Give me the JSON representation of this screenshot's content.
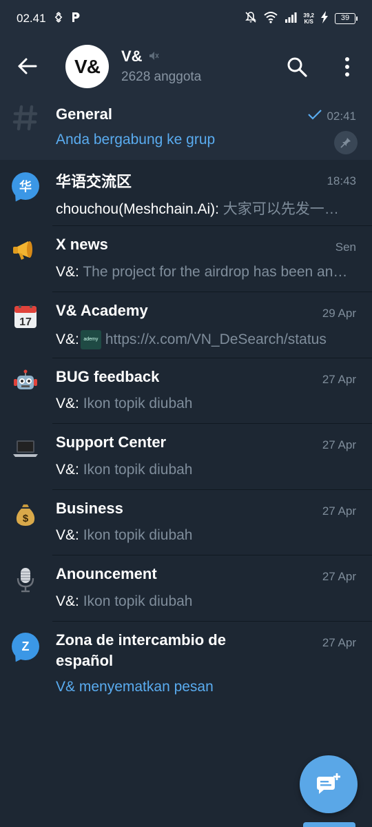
{
  "status_bar": {
    "time": "02.41",
    "net_speed_value": "39,2",
    "net_speed_unit": "K/S",
    "battery": "39"
  },
  "header": {
    "avatar_text": "V&",
    "title": "V&",
    "subtitle": "2628 anggota"
  },
  "topics": [
    {
      "icon": "hash-icon",
      "title": "General",
      "time": "02:41",
      "sender": "",
      "message": "Anda bergabung ke grup",
      "message_style": "blue",
      "pinned": true,
      "read": true
    },
    {
      "icon": "chinese-bubble-icon",
      "badge": "华",
      "title": "华语交流区",
      "time": "18:43",
      "sender": "chouchou(Meshchain.Ai):",
      "message": " 大家可以先发一下自己的钱包地址",
      "message_style": "normal"
    },
    {
      "icon": "megaphone-icon",
      "title": "X news",
      "time": "Sen",
      "sender": "V&:",
      "message": " The project for the airdrop has been announced",
      "message_style": "normal"
    },
    {
      "icon": "calendar-icon",
      "title": "V& Academy",
      "time": "29 Apr",
      "sender": "V&:",
      "thumb": "ademy",
      "message": " https://x.com/VN_DeSearch/status",
      "message_style": "normal"
    },
    {
      "icon": "robot-icon",
      "title": "BUG feedback",
      "time": "27 Apr",
      "sender": "V&:",
      "message": " Ikon topik diubah",
      "message_style": "normal"
    },
    {
      "icon": "laptop-icon",
      "title": "Support Center",
      "time": "27 Apr",
      "sender": "V&:",
      "message": " Ikon topik diubah",
      "message_style": "normal"
    },
    {
      "icon": "money-bag-icon",
      "title": "Business",
      "time": "27 Apr",
      "sender": "V&:",
      "message": " Ikon topik diubah",
      "message_style": "normal"
    },
    {
      "icon": "microphone-icon",
      "title": "Anouncement",
      "time": "27 Apr",
      "sender": "V&:",
      "message": " Ikon topik diubah",
      "message_style": "normal"
    },
    {
      "icon": "letter-z-bubble-icon",
      "badge": "Z",
      "title_line1": "Zona de intercambio de",
      "title_line2": "español",
      "time": "27 Apr",
      "sender": "",
      "message": "V& menyematkan pesan",
      "message_style": "blue"
    }
  ],
  "colors": {
    "background": "#1d2733",
    "header": "#232e3c",
    "accent": "#5aa7e7",
    "muted": "#7f8d9b"
  }
}
